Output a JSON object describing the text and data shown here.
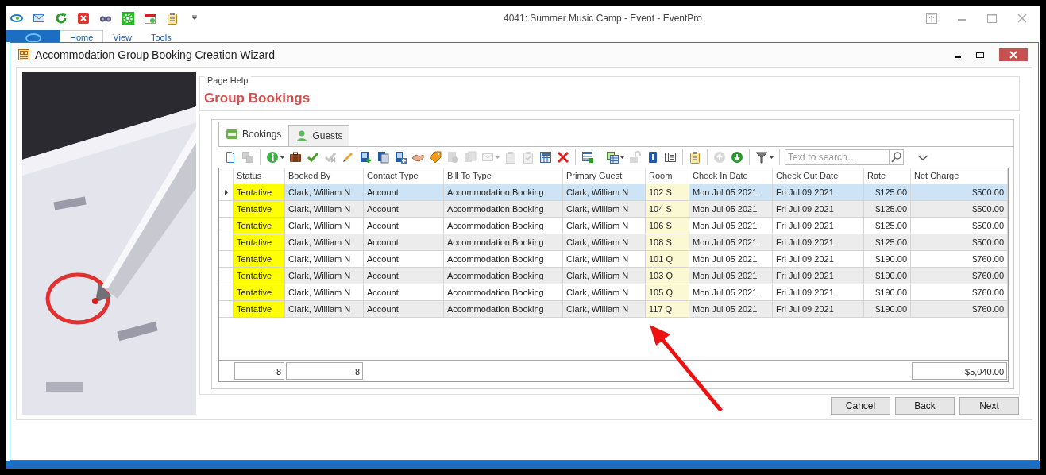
{
  "app": {
    "title": "4041: Summer Music Camp - Event - EventPro",
    "ribbon_tabs": [
      {
        "label": "Home",
        "selected": true
      },
      {
        "label": "View",
        "selected": false
      },
      {
        "label": "Tools",
        "selected": false
      }
    ]
  },
  "dialog": {
    "title": "Accommodation Group Booking Creation Wizard",
    "help_label": "Page Help",
    "heading": "Group Bookings",
    "tabs": [
      {
        "label": "Bookings",
        "selected": true
      },
      {
        "label": "Guests",
        "selected": false
      }
    ],
    "toolbar": [
      {
        "kind": "button",
        "disabled": false,
        "menu": false
      },
      {
        "kind": "button",
        "disabled": true,
        "menu": false
      },
      {
        "kind": "separator"
      },
      {
        "kind": "button",
        "disabled": false,
        "menu": true
      },
      {
        "kind": "button",
        "disabled": false,
        "menu": false
      },
      {
        "kind": "button",
        "disabled": false,
        "menu": false
      },
      {
        "kind": "button",
        "disabled": true,
        "menu": false
      },
      {
        "kind": "button",
        "disabled": false,
        "menu": false
      },
      {
        "kind": "button",
        "disabled": false,
        "menu": false
      },
      {
        "kind": "button",
        "disabled": false,
        "menu": false
      },
      {
        "kind": "button",
        "disabled": false,
        "menu": false
      },
      {
        "kind": "button",
        "disabled": false,
        "menu": false
      },
      {
        "kind": "button",
        "disabled": false,
        "menu": false
      },
      {
        "kind": "button",
        "disabled": true,
        "menu": false
      },
      {
        "kind": "button",
        "disabled": true,
        "menu": false
      },
      {
        "kind": "button",
        "disabled": true,
        "menu": true
      },
      {
        "kind": "button",
        "disabled": true,
        "menu": false
      },
      {
        "kind": "button",
        "disabled": true,
        "menu": false
      },
      {
        "kind": "button",
        "disabled": false,
        "menu": false
      },
      {
        "kind": "button",
        "disabled": false,
        "menu": false
      },
      {
        "kind": "separator"
      },
      {
        "kind": "button",
        "disabled": false,
        "menu": false
      },
      {
        "kind": "separator"
      },
      {
        "kind": "button",
        "disabled": false,
        "menu": true
      },
      {
        "kind": "button",
        "disabled": true,
        "menu": false
      },
      {
        "kind": "button",
        "disabled": false,
        "menu": false
      },
      {
        "kind": "button",
        "disabled": false,
        "menu": false
      },
      {
        "kind": "separator"
      },
      {
        "kind": "button",
        "disabled": false,
        "menu": false
      },
      {
        "kind": "separator"
      },
      {
        "kind": "button",
        "disabled": true,
        "menu": false
      },
      {
        "kind": "button",
        "disabled": false,
        "menu": false
      },
      {
        "kind": "separator"
      },
      {
        "kind": "button",
        "disabled": false,
        "menu": true
      },
      {
        "kind": "separator"
      }
    ],
    "search": {
      "placeholder": "Text to search…"
    },
    "columns": [
      "Status",
      "Booked By",
      "Contact Type",
      "Bill To Type",
      "Primary Guest",
      "Room",
      "Check In Date",
      "Check Out Date",
      "Rate",
      "Net Charge"
    ],
    "rows": [
      {
        "selected": true,
        "status": "Tentative",
        "color": "#ffff00",
        "booked_by": "Clark, William N",
        "contact_type": "Account",
        "bill_to_type": "Accommodation Booking",
        "primary_guest": "Clark, William N",
        "room": "102 S",
        "check_in": "Mon Jul 05 2021",
        "check_out": "Fri Jul 09 2021",
        "rate": "$125.00",
        "net_charge": "$500.00"
      },
      {
        "selected": false,
        "status": "Tentative",
        "color": "#ffff00",
        "booked_by": "Clark, William N",
        "contact_type": "Account",
        "bill_to_type": "Accommodation Booking",
        "primary_guest": "Clark, William N",
        "room": "104 S",
        "check_in": "Mon Jul 05 2021",
        "check_out": "Fri Jul 09 2021",
        "rate": "$125.00",
        "net_charge": "$500.00"
      },
      {
        "selected": false,
        "status": "Tentative",
        "color": "#ffff00",
        "booked_by": "Clark, William N",
        "contact_type": "Account",
        "bill_to_type": "Accommodation Booking",
        "primary_guest": "Clark, William N",
        "room": "106 S",
        "check_in": "Mon Jul 05 2021",
        "check_out": "Fri Jul 09 2021",
        "rate": "$125.00",
        "net_charge": "$500.00"
      },
      {
        "selected": false,
        "status": "Tentative",
        "color": "#ffff00",
        "booked_by": "Clark, William N",
        "contact_type": "Account",
        "bill_to_type": "Accommodation Booking",
        "primary_guest": "Clark, William N",
        "room": "108 S",
        "check_in": "Mon Jul 05 2021",
        "check_out": "Fri Jul 09 2021",
        "rate": "$125.00",
        "net_charge": "$500.00"
      },
      {
        "selected": false,
        "status": "Tentative",
        "color": "#ffff00",
        "booked_by": "Clark, William N",
        "contact_type": "Account",
        "bill_to_type": "Accommodation Booking",
        "primary_guest": "Clark, William N",
        "room": "101 Q",
        "check_in": "Mon Jul 05 2021",
        "check_out": "Fri Jul 09 2021",
        "rate": "$190.00",
        "net_charge": "$760.00"
      },
      {
        "selected": false,
        "status": "Tentative",
        "color": "#ffff00",
        "booked_by": "Clark, William N",
        "contact_type": "Account",
        "bill_to_type": "Accommodation Booking",
        "primary_guest": "Clark, William N",
        "room": "103 Q",
        "check_in": "Mon Jul 05 2021",
        "check_out": "Fri Jul 09 2021",
        "rate": "$190.00",
        "net_charge": "$760.00"
      },
      {
        "selected": false,
        "status": "Tentative",
        "color": "#ffff00",
        "booked_by": "Clark, William N",
        "contact_type": "Account",
        "bill_to_type": "Accommodation Booking",
        "primary_guest": "Clark, William N",
        "room": "105 Q",
        "check_in": "Mon Jul 05 2021",
        "check_out": "Fri Jul 09 2021",
        "rate": "$190.00",
        "net_charge": "$760.00"
      },
      {
        "selected": false,
        "status": "Tentative",
        "color": "#ffff00",
        "booked_by": "Clark, William N",
        "contact_type": "Account",
        "bill_to_type": "Accommodation Booking",
        "primary_guest": "Clark, William N",
        "room": "117 Q",
        "check_in": "Mon Jul 05 2021",
        "check_out": "Fri Jul 09 2021",
        "rate": "$190.00",
        "net_charge": "$760.00"
      }
    ],
    "footer": {
      "status_count": "8",
      "booked_by_count": "8",
      "net_charge_total": "$5,040.00"
    },
    "buttons": [
      "Cancel",
      "Back",
      "Next"
    ]
  }
}
